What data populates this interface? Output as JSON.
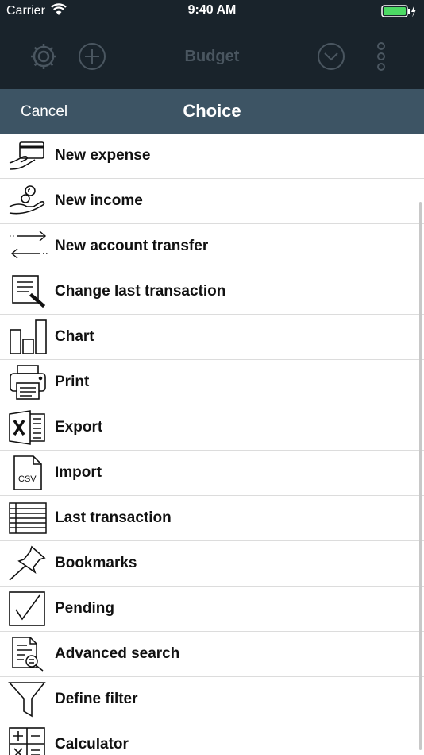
{
  "status_bar": {
    "carrier": "Carrier",
    "time": "9:40 AM"
  },
  "background_nav": {
    "title": "Budget"
  },
  "sheet": {
    "cancel_label": "Cancel",
    "title": "Choice"
  },
  "colors": {
    "dark": "#19232b",
    "header": "#3d5464",
    "battery": "#4cd964"
  },
  "menu": [
    {
      "label": "New expense",
      "icon": "card-hand-icon"
    },
    {
      "label": "New income",
      "icon": "coin-hand-icon"
    },
    {
      "label": "New account transfer",
      "icon": "transfer-arrows-icon"
    },
    {
      "label": "Change last transaction",
      "icon": "edit-document-icon"
    },
    {
      "label": "Chart",
      "icon": "bar-chart-icon"
    },
    {
      "label": "Print",
      "icon": "printer-icon"
    },
    {
      "label": "Export",
      "icon": "excel-export-icon"
    },
    {
      "label": "Import",
      "icon": "csv-file-icon"
    },
    {
      "label": "Last transaction",
      "icon": "list-lines-icon"
    },
    {
      "label": "Bookmarks",
      "icon": "pushpin-icon"
    },
    {
      "label": "Pending",
      "icon": "checkbox-icon"
    },
    {
      "label": "Advanced search",
      "icon": "document-search-icon"
    },
    {
      "label": "Define filter",
      "icon": "funnel-icon"
    },
    {
      "label": "Calculator",
      "icon": "calculator-icon"
    }
  ]
}
